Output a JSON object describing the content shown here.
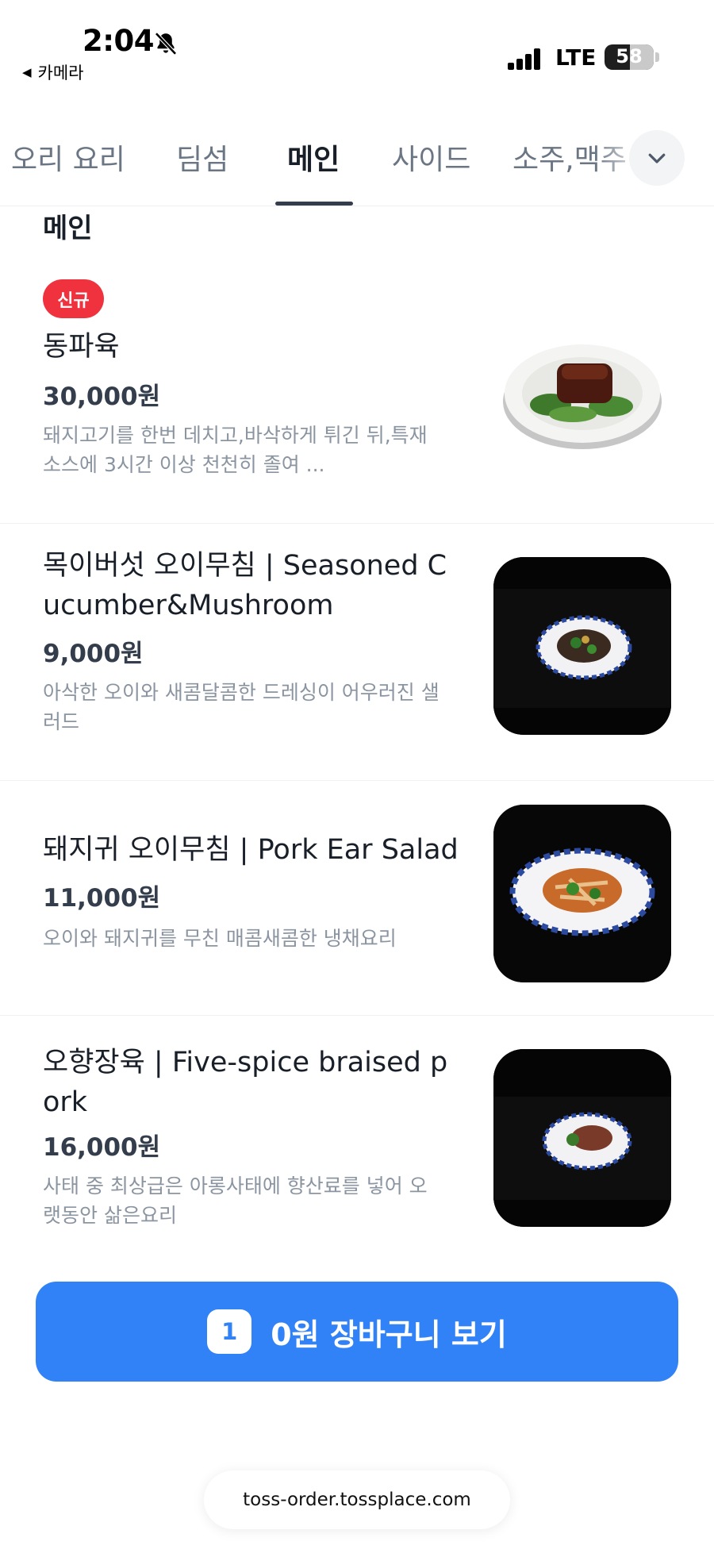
{
  "status_bar": {
    "time": "2:04",
    "back_app": "카메라",
    "network": "LTE",
    "battery": "58",
    "icons": [
      "bell-off-icon",
      "signal-icon",
      "battery-icon"
    ]
  },
  "tabs": [
    {
      "label": "오리 요리",
      "active": false
    },
    {
      "label": "딤섬",
      "active": false
    },
    {
      "label": "메인",
      "active": true
    },
    {
      "label": "사이드",
      "active": false
    },
    {
      "label": "소주,맥주",
      "active": false
    }
  ],
  "tabs_more_icon": "chevron-down-icon",
  "section": {
    "title": "메인",
    "items": [
      {
        "badge": "신규",
        "name": "동파육",
        "price": "30,000원",
        "description": "돼지고기를 한번 데치고,바삭하게 튀긴 뒤,특재소스에 3시간 이상 천천히 졸여 ..."
      },
      {
        "name": "목이버섯 오이무침 | Seasoned Cucumber&Mushroom",
        "price": "9,000원",
        "description": "아삭한 오이와 새콤달콤한 드레싱이 어우러진 샐러드"
      },
      {
        "name": "돼지귀 오이무침 | Pork Ear Salad",
        "price": "11,000원",
        "description": "오이와 돼지귀를 무친 매콤새콤한 냉채요리"
      },
      {
        "name": "오향장육 | Five-spice braised pork",
        "price": "16,000원",
        "description": "사태 중 최상급은 아롱사태에 향산료를 넣어 오랫동안 삶은요리"
      }
    ]
  },
  "cart": {
    "count": "1",
    "label": "0원 장바구니 보기"
  },
  "url": "toss-order.tossplace.com",
  "colors": {
    "accent": "#3182f6",
    "badge_red": "#f0323f",
    "text_primary": "#191f28",
    "text_secondary": "#8b95a1"
  }
}
